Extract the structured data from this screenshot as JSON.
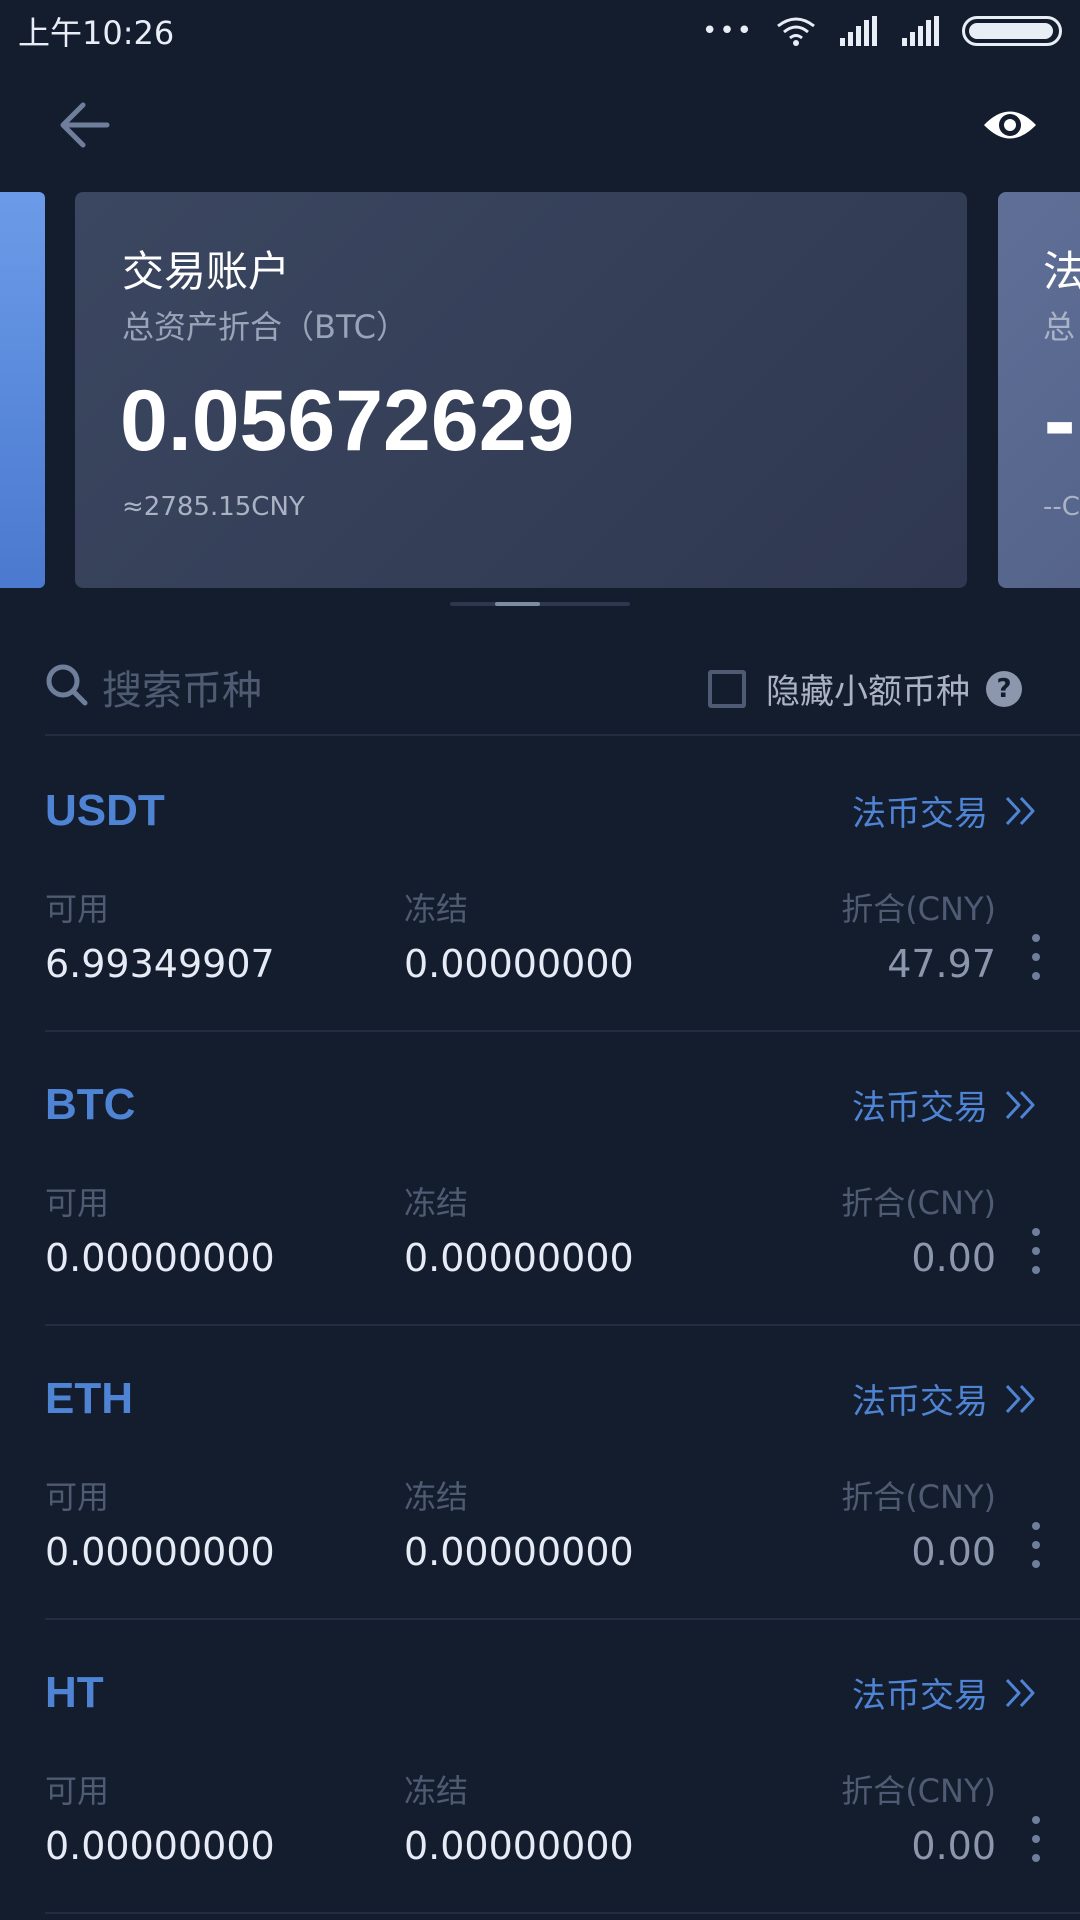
{
  "status_bar": {
    "time": "上午10:26",
    "dots": "•••"
  },
  "header": {
    "back_icon": "arrow-left-icon",
    "eye_icon": "eye-icon"
  },
  "cards": {
    "main": {
      "title": "交易账户",
      "subtitle": "总资产折合（BTC）",
      "value": "0.05672629",
      "approx": "≈2785.15CNY"
    },
    "peek": {
      "title": "法",
      "subtitle": "总",
      "value": "-",
      "approx": "--C"
    },
    "pager": {
      "count": 3,
      "active": 1
    }
  },
  "search": {
    "placeholder": "搜索币种",
    "value": "",
    "hide_small_label": "隐藏小额币种",
    "hide_small_checked": false,
    "help": "?"
  },
  "labels": {
    "available": "可用",
    "frozen": "冻结",
    "valuation": "折合(CNY)",
    "fiat_trade": "法币交易"
  },
  "assets": [
    {
      "name": "USDT",
      "available": "6.99349907",
      "frozen": "0.00000000",
      "valuation": "47.97"
    },
    {
      "name": "BTC",
      "available": "0.00000000",
      "frozen": "0.00000000",
      "valuation": "0.00"
    },
    {
      "name": "ETH",
      "available": "0.00000000",
      "frozen": "0.00000000",
      "valuation": "0.00"
    },
    {
      "name": "HT",
      "available": "0.00000000",
      "frozen": "0.00000000",
      "valuation": "0.00"
    }
  ],
  "colors": {
    "background": "#141d2e",
    "accent": "#4f84d4",
    "card": "#3b4660",
    "muted": "#4f5b72"
  }
}
